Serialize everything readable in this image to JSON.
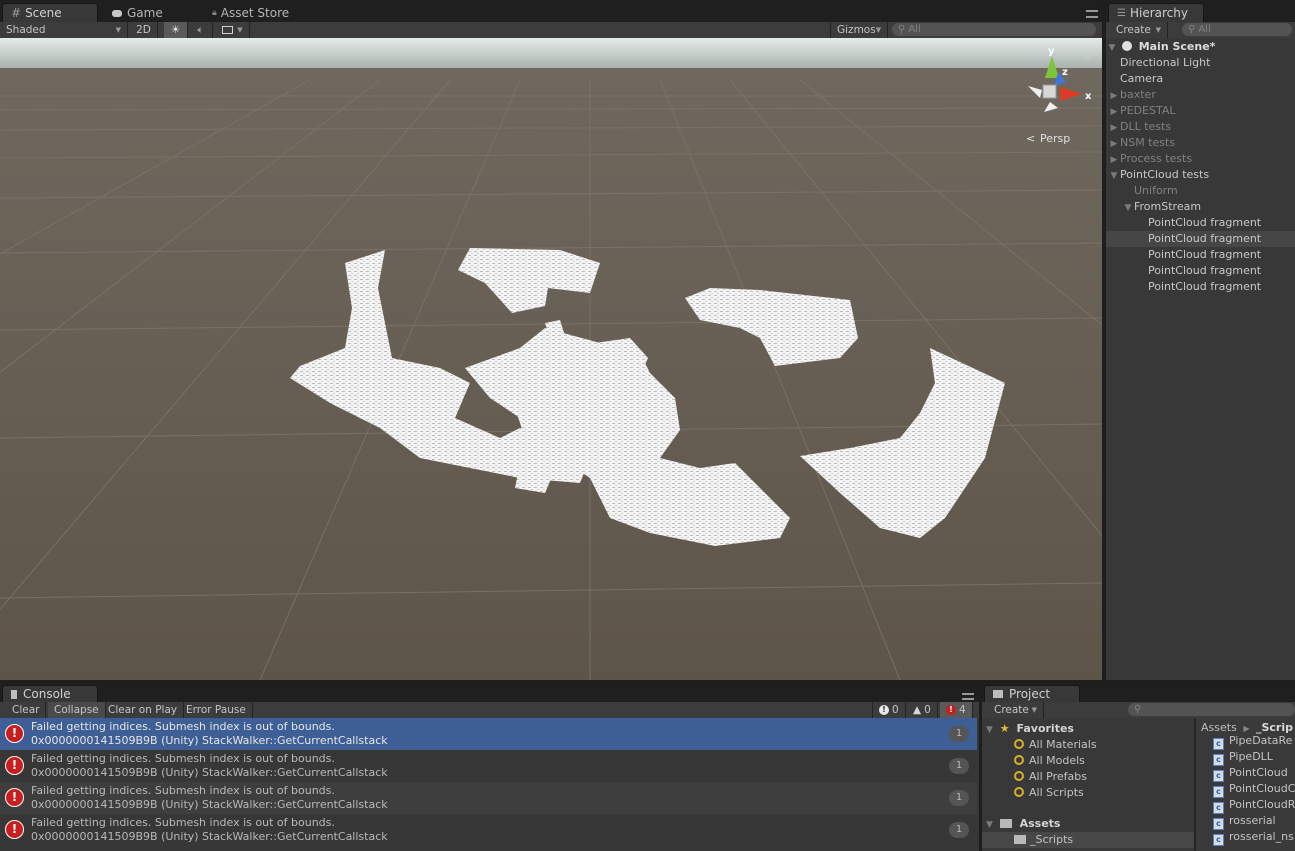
{
  "scene_tabs": {
    "scene": "Scene",
    "game": "Game",
    "asset_store": "Asset Store"
  },
  "scene_toolbar": {
    "shading_mode": "Shaded",
    "mode_2d": "2D",
    "gizmos": "Gizmos",
    "search_placeholder": "All"
  },
  "viewport": {
    "projection_label": "Persp",
    "axis_x": "x",
    "axis_y": "y",
    "axis_z": "z"
  },
  "hierarchy": {
    "tab": "Hierarchy",
    "create": "Create",
    "search_placeholder": "All",
    "scene_name": "Main Scene*",
    "items": [
      {
        "label": "Directional Light",
        "indent": 1,
        "state": "none",
        "style": "normal"
      },
      {
        "label": "Camera",
        "indent": 1,
        "state": "none",
        "style": "normal"
      },
      {
        "label": "baxter",
        "indent": 1,
        "state": "collapsed",
        "style": "dim"
      },
      {
        "label": "PEDESTAL",
        "indent": 1,
        "state": "collapsed",
        "style": "dim"
      },
      {
        "label": "DLL tests",
        "indent": 1,
        "state": "collapsed",
        "style": "dim"
      },
      {
        "label": "NSM tests",
        "indent": 1,
        "state": "collapsed",
        "style": "dim"
      },
      {
        "label": "Process tests",
        "indent": 1,
        "state": "collapsed",
        "style": "dim"
      },
      {
        "label": "PointCloud tests",
        "indent": 1,
        "state": "expanded",
        "style": "normal"
      },
      {
        "label": "Uniform",
        "indent": 2,
        "state": "none",
        "style": "dim"
      },
      {
        "label": "FromStream",
        "indent": 2,
        "state": "expanded",
        "style": "normal"
      },
      {
        "label": "PointCloud fragment",
        "indent": 3,
        "state": "none",
        "style": "normal"
      },
      {
        "label": "PointCloud fragment",
        "indent": 3,
        "state": "none",
        "style": "selected"
      },
      {
        "label": "PointCloud fragment",
        "indent": 3,
        "state": "none",
        "style": "normal"
      },
      {
        "label": "PointCloud fragment",
        "indent": 3,
        "state": "none",
        "style": "normal"
      },
      {
        "label": "PointCloud fragment",
        "indent": 3,
        "state": "none",
        "style": "normal"
      }
    ]
  },
  "console": {
    "tab": "Console",
    "buttons": {
      "clear": "Clear",
      "collapse": "Collapse",
      "clear_on_play": "Clear on Play",
      "error_pause": "Error Pause"
    },
    "counts": {
      "info": "0",
      "warnings": "0",
      "errors": "4"
    },
    "entries": [
      {
        "line1": "Failed getting indices. Submesh index is out of bounds.",
        "line2": "0x0000000141509B9B (Unity) StackWalker::GetCurrentCallstack",
        "count": "1",
        "selected": true
      },
      {
        "line1": "Failed getting indices. Submesh index is out of bounds.",
        "line2": "0x0000000141509B9B (Unity) StackWalker::GetCurrentCallstack",
        "count": "1",
        "selected": false
      },
      {
        "line1": "Failed getting indices. Submesh index is out of bounds.",
        "line2": "0x0000000141509B9B (Unity) StackWalker::GetCurrentCallstack",
        "count": "1",
        "selected": false
      },
      {
        "line1": "Failed getting indices. Submesh index is out of bounds.",
        "line2": "0x0000000141509B9B (Unity) StackWalker::GetCurrentCallstack",
        "count": "1",
        "selected": false
      }
    ]
  },
  "project": {
    "tab": "Project",
    "create": "Create",
    "favorites_label": "Favorites",
    "favorites": [
      "All Materials",
      "All Models",
      "All Prefabs",
      "All Scripts"
    ],
    "assets_label": "Assets",
    "asset_folders": [
      "_Scripts"
    ],
    "breadcrumb": [
      "Assets",
      "_Scrip"
    ],
    "files": [
      "PipeDataRe",
      "PipeDLL",
      "PointCloud",
      "PointCloudC",
      "PointCloudR",
      "rosserial",
      "rosserial_ns"
    ]
  }
}
